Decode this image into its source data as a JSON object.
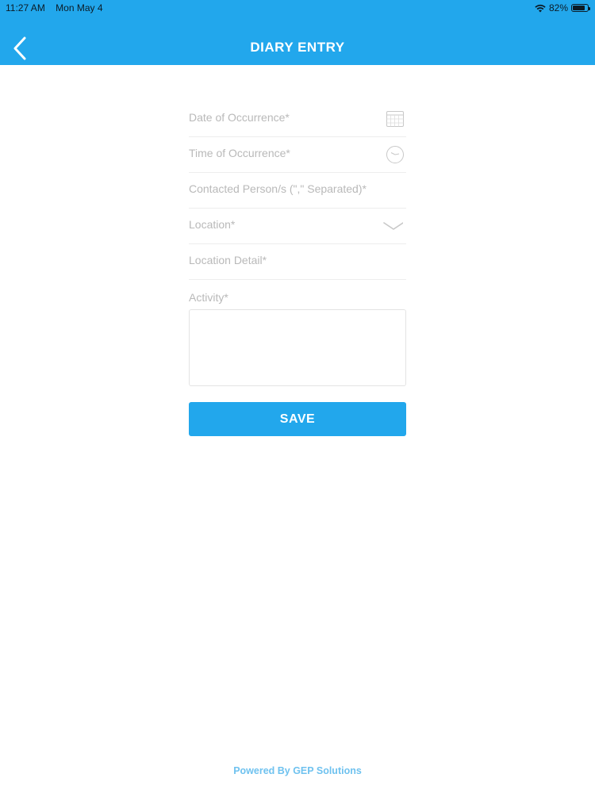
{
  "status_bar": {
    "time": "11:27 AM",
    "date": "Mon May 4",
    "battery": "82%",
    "battery_level": 0.82
  },
  "header": {
    "title": "DIARY ENTRY",
    "back_icon": "chevron-left-icon",
    "background": "#22a7ec"
  },
  "form": {
    "date_placeholder": "Date of Occurrence*",
    "time_placeholder": "Time of Occurrence*",
    "contacted_placeholder": "Contacted Person/s (\",\"  Separated)*",
    "location_placeholder": "Location*",
    "location_detail_placeholder": "Location Detail*",
    "activity_label": "Activity*",
    "activity_value": "",
    "save_label": "SAVE"
  },
  "footer": {
    "text": "Powered By GEP Solutions"
  }
}
